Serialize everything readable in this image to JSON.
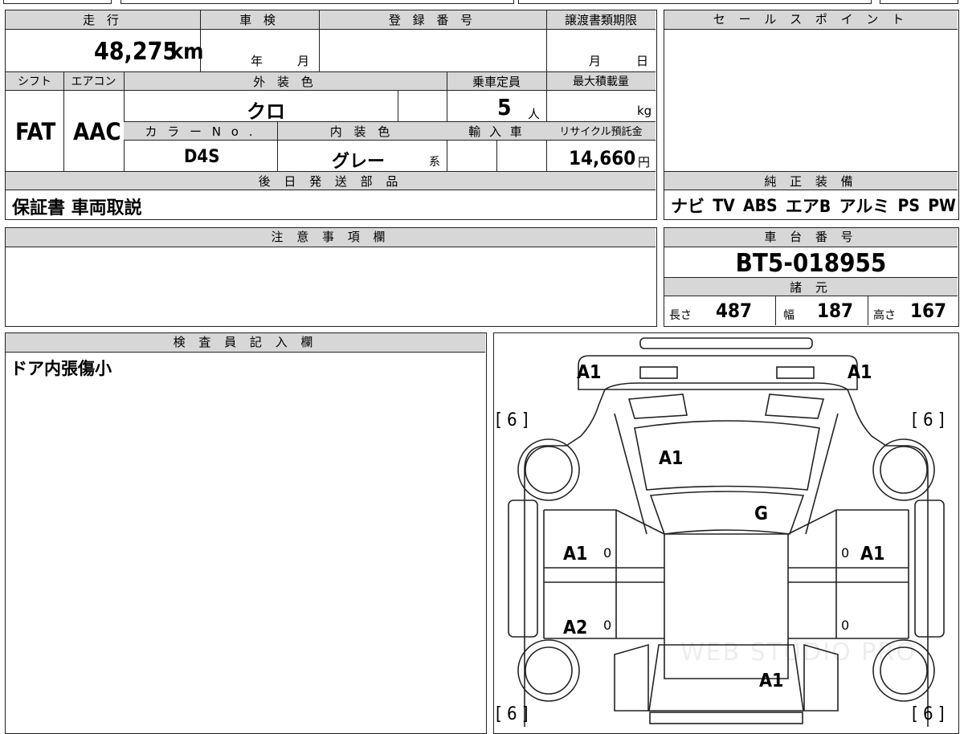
{
  "labels": {
    "mileage": "走 行",
    "inspection": "車 検",
    "registration": "登 録 番 号",
    "transfer_deadline": "譲渡書類期限",
    "shift": "シフト",
    "aircon": "エアコン",
    "exterior_color": "外 装 色",
    "capacity": "乗車定員",
    "max_load": "最大積載量",
    "color_no": "カ ラ ー N o .",
    "interior_color": "内 装 色",
    "import": "輸 入 車",
    "recycle": "リサイクル預託金",
    "later_parts": "後 日 発 送 部 品",
    "sales_point": "セ ー ル ス ポ イ ン ト",
    "genuine_equipment": "純 正 装 備",
    "notes": "注 意 事 項 欄",
    "chassis_no": "車 台 番 号",
    "specs": "諸 元",
    "inspector": "検 査 員 記 入 欄"
  },
  "vehicle": {
    "mileage": "48,275",
    "mileage_unit": "km",
    "year_unit": "年",
    "month_unit": "月",
    "transfer_month": "月",
    "transfer_day": "日",
    "shift": "FAT",
    "aircon": "AAC",
    "exterior_color": "クロ",
    "capacity": "5",
    "capacity_unit": "人",
    "load_unit": "kg",
    "color_no": "D4S",
    "interior_color": "グレー",
    "interior_suffix": "系",
    "recycle_fee": "14,660",
    "recycle_unit": "円",
    "later_parts": "保証書 車両取説",
    "equipment": [
      "ナビ",
      "TV",
      "ABS",
      "エアB",
      "アルミ",
      "PS",
      "PW"
    ],
    "chassis_no": "BT5-018955",
    "length_label": "長さ",
    "length": "487",
    "width_label": "幅",
    "width": "187",
    "height_label": "高さ",
    "height": "167",
    "inspector_note": "ドア内張傷小"
  },
  "diagram": {
    "marks": [
      "A1",
      "A1",
      "A1",
      "G",
      "A1",
      "A1",
      "A2",
      "A1"
    ],
    "tire_marks": [
      "[ 6 ]",
      "[ 6 ]",
      "[ 6 ]",
      "[ 6 ]"
    ],
    "small_zeros": [
      "0",
      "0",
      "0",
      "0"
    ],
    "watermark": "WEB STUDIO PRO"
  }
}
